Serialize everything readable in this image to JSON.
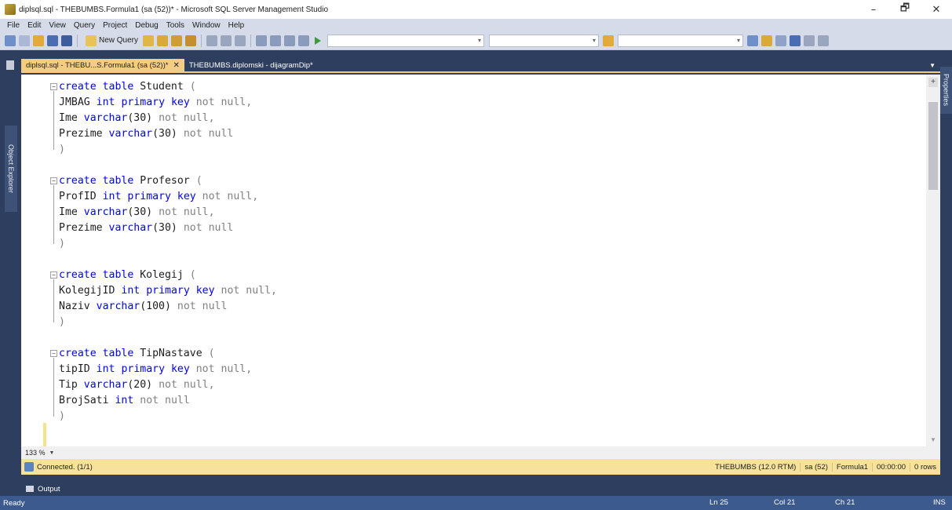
{
  "window": {
    "title": "diplsql.sql - THEBUMBS.Formula1 (sa (52))* - Microsoft SQL Server Management Studio",
    "controls": {
      "minimize": "–",
      "maximize": "🗗",
      "close": "✕"
    }
  },
  "menu": [
    "File",
    "Edit",
    "View",
    "Query",
    "Project",
    "Debug",
    "Tools",
    "Window",
    "Help"
  ],
  "toolbar": {
    "new_query_label": "New Query"
  },
  "side_panels": {
    "left": "Object Explorer",
    "right": "Properties"
  },
  "tabs": [
    {
      "label": "diplsql.sql - THEBU...S.Formula1 (sa (52))*",
      "active": true,
      "close": "✕"
    },
    {
      "label": "THEBUMBS.diplomski - dijagramDip*",
      "active": false
    }
  ],
  "editor": {
    "blocks": [
      {
        "header": {
          "kw": "create table",
          "name": "Student",
          "open": "("
        },
        "lines": [
          {
            "name": "JMBAG",
            "type": "int",
            "extra": "primary key",
            "rest": "not null,"
          },
          {
            "name": "Ime",
            "type": "varchar",
            "arg": "(30)",
            "rest": "not null,"
          },
          {
            "name": "Prezime",
            "type": "varchar",
            "arg": "(30)",
            "rest": "not null"
          }
        ],
        "close": ")"
      },
      {
        "header": {
          "kw": "create table",
          "name": "Profesor",
          "open": "("
        },
        "lines": [
          {
            "name": "ProfID",
            "type": "int",
            "extra": "primary key",
            "rest": "not null,"
          },
          {
            "name": "Ime",
            "type": "varchar",
            "arg": "(30)",
            "rest": "not null,"
          },
          {
            "name": "Prezime",
            "type": "varchar",
            "arg": "(30)",
            "rest": "not null"
          }
        ],
        "close": ")"
      },
      {
        "header": {
          "kw": "create table",
          "name": "Kolegij",
          "open": "("
        },
        "lines": [
          {
            "name": "KolegijID",
            "type": "int",
            "extra": "primary key",
            "rest": "not null,"
          },
          {
            "name": "Naziv",
            "type": "varchar",
            "arg": "(100)",
            "rest": "not null"
          }
        ],
        "close": ")"
      },
      {
        "header": {
          "kw": "create table",
          "name": "TipNastave",
          "open": "("
        },
        "lines": [
          {
            "name": "tipID",
            "type": "int",
            "extra": "primary key",
            "rest": "not null,"
          },
          {
            "name": "Tip",
            "type": "varchar",
            "arg": "(20)",
            "rest": "not null,"
          },
          {
            "name": "BrojSati",
            "type": "int",
            "rest": "not null"
          }
        ],
        "close": ")"
      }
    ],
    "zoom": "133 %"
  },
  "connection": {
    "status": "Connected. (1/1)",
    "server": "THEBUMBS (12.0 RTM)",
    "user": "sa (52)",
    "database": "Formula1",
    "elapsed": "00:00:00",
    "rows": "0 rows"
  },
  "output_label": "Output",
  "status": {
    "ready": "Ready",
    "ln": "Ln 25",
    "col": "Col 21",
    "ch": "Ch 21",
    "mode": "INS"
  }
}
